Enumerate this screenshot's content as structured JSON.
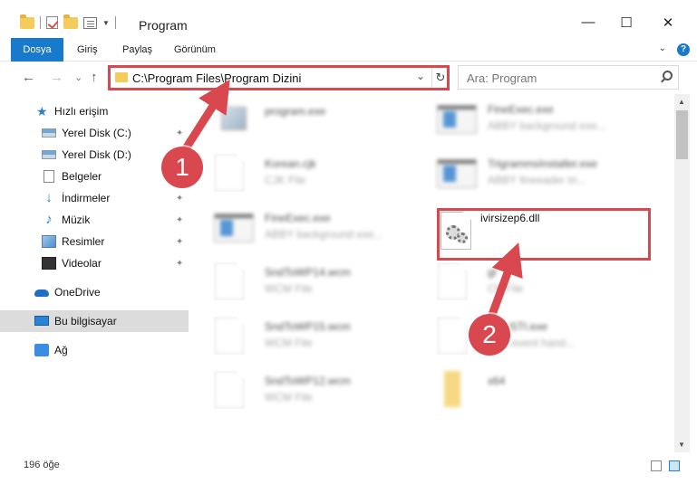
{
  "window": {
    "title": "Program",
    "min": "—",
    "max": "☐",
    "close": "✕"
  },
  "ribbon": {
    "tabs": [
      "Dosya",
      "Giriş",
      "Paylaş",
      "Görünüm"
    ],
    "expand": "⌄",
    "help": "?"
  },
  "nav": {
    "back": "←",
    "forward": "→",
    "recent": "⌄",
    "up": "↑",
    "address": "C:\\Program Files\\Program Dizini",
    "address_dropdown": "⌄",
    "refresh": "↻",
    "search_placeholder": "Ara: Program"
  },
  "sidebar": {
    "items": [
      {
        "label": "Hızlı erişim",
        "icon": "star-icon"
      },
      {
        "label": "Yerel Disk (C:)",
        "icon": "drive-icon",
        "pinned": true
      },
      {
        "label": "Yerel Disk (D:)",
        "icon": "drive-icon"
      },
      {
        "label": "Belgeler",
        "icon": "document-icon"
      },
      {
        "label": "İndirmeler",
        "icon": "download-icon",
        "pinned": true
      },
      {
        "label": "Müzik",
        "icon": "music-icon",
        "pinned": true
      },
      {
        "label": "Resimler",
        "icon": "pictures-icon",
        "pinned": true
      },
      {
        "label": "Videolar",
        "icon": "video-icon",
        "pinned": true
      },
      {
        "label": "OneDrive",
        "icon": "onedrive-icon"
      },
      {
        "label": "Bu bilgisayar",
        "icon": "computer-icon",
        "selected": true
      },
      {
        "label": "Ağ",
        "icon": "network-icon"
      }
    ],
    "pin_glyph": "📌"
  },
  "files": [
    {
      "name": "program.exe",
      "type": "",
      "icon": "image-icon"
    },
    {
      "name": "FineExec.exe",
      "type": "ABBY background exe...",
      "icon": "exe-icon"
    },
    {
      "name": "Korean.cjk",
      "type": "CJK File",
      "icon": "file-icon"
    },
    {
      "name": "TrigrammsInstaller.exe",
      "type": "ABBY fineeader tri...",
      "icon": "exe-icon"
    },
    {
      "name": "FineExec.exe",
      "type": "ABBY background exe...",
      "icon": "exe-icon"
    },
    {
      "name": "ivirsizep6.dll",
      "type": "",
      "icon": "dll-gear-icon",
      "highlighted": true
    },
    {
      "name": "SndToWP14.wcm",
      "type": "WCM File",
      "icon": "file-icon"
    },
    {
      "name": "gl",
      "type": "CK File",
      "icon": "file-icon"
    },
    {
      "name": "SndToWP15.wcm",
      "type": "WCM File",
      "icon": "file-icon"
    },
    {
      "name": "ybyySTI.exe",
      "type": "Y sti event hand...",
      "icon": "file-icon"
    },
    {
      "name": "SndToWP12.wcm",
      "type": "WCM File",
      "icon": "file-icon"
    },
    {
      "name": "x64",
      "type": "",
      "icon": "folder-icon"
    }
  ],
  "annotations": {
    "step1": "1",
    "step2": "2",
    "highlight_color": "#d9474f"
  },
  "status": {
    "count": "196 öğe"
  },
  "colors": {
    "accent": "#1979ca",
    "selected_nav": "#dcdcdc",
    "annotation": "#d9474f"
  }
}
